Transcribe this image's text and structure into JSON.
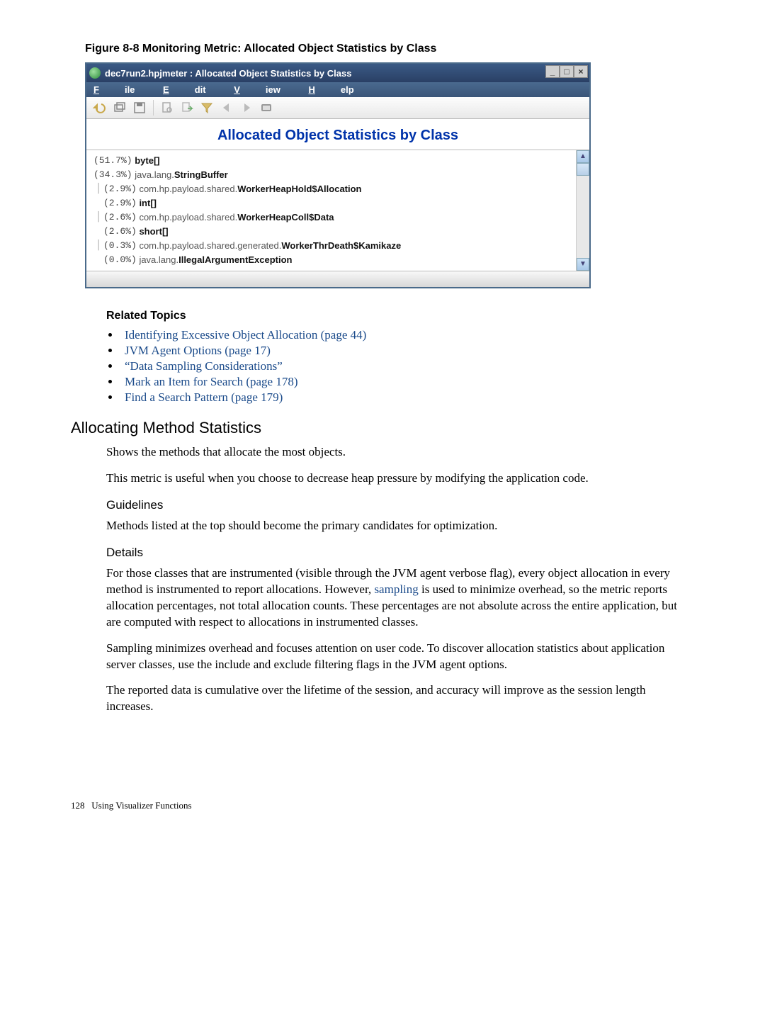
{
  "figure_caption": "Figure 8-8 Monitoring Metric: Allocated Object Statistics by Class",
  "window": {
    "title": "dec7run2.hpjmeter : Allocated Object Statistics by Class",
    "menus": {
      "file": "File",
      "edit": "Edit",
      "view": "View",
      "help": "Help"
    },
    "content_title": "Allocated Object Statistics by Class",
    "rows": [
      {
        "pct": "(51.7%)",
        "pkg": "",
        "cls": "byte[]"
      },
      {
        "pct": "(34.3%)",
        "pkg": "java.lang.",
        "cls": "StringBuffer"
      },
      {
        "pct": "(2.9%)",
        "pkg": "com.hp.payload.shared.",
        "cls": "WorkerHeapHold$Allocation"
      },
      {
        "pct": "(2.9%)",
        "pkg": "",
        "cls": "int[]"
      },
      {
        "pct": "(2.6%)",
        "pkg": "com.hp.payload.shared.",
        "cls": "WorkerHeapColl$Data"
      },
      {
        "pct": "(2.6%)",
        "pkg": "",
        "cls": "short[]"
      },
      {
        "pct": "(0.3%)",
        "pkg": "com.hp.payload.shared.generated.",
        "cls": "WorkerThrDeath$Kamikaze"
      },
      {
        "pct": "(0.0%)",
        "pkg": "java.lang.",
        "cls": "IllegalArgumentException"
      }
    ]
  },
  "related_heading": "Related Topics",
  "related": [
    {
      "text": "Identifying Excessive Object Allocation (page 44)"
    },
    {
      "text": "JVM Agent Options (page 17)"
    },
    {
      "text": "“Data Sampling Considerations”"
    },
    {
      "text": "Mark an Item for Search (page 178)"
    },
    {
      "text": "Find a Search Pattern (page 179)"
    }
  ],
  "h2": "Allocating Method Statistics",
  "p1": "Shows the methods that allocate the most objects.",
  "p2": "This metric is useful when you choose to decrease heap pressure by modifying the application code.",
  "guidelines_h": "Guidelines",
  "p3": "Methods listed at the top should become the primary candidates for optimization.",
  "details_h": "Details",
  "p4a": "For those classes that are instrumented (visible through the JVM agent verbose flag), every object allocation in every method is instrumented to report allocations. However, ",
  "p4link": "sampling",
  "p4b": " is used to minimize overhead, so the metric reports allocation percentages, not total allocation counts. These percentages are not absolute across the entire application, but are computed with respect to allocations in instrumented classes.",
  "p5": "Sampling minimizes overhead and focuses attention on user code. To discover allocation statistics about application server classes, use the include and exclude filtering flags in the JVM agent options.",
  "p6": "The reported data is cumulative over the lifetime of the session, and accuracy will improve as the session length increases.",
  "footer_page": "128",
  "footer_text": "Using Visualizer Functions"
}
